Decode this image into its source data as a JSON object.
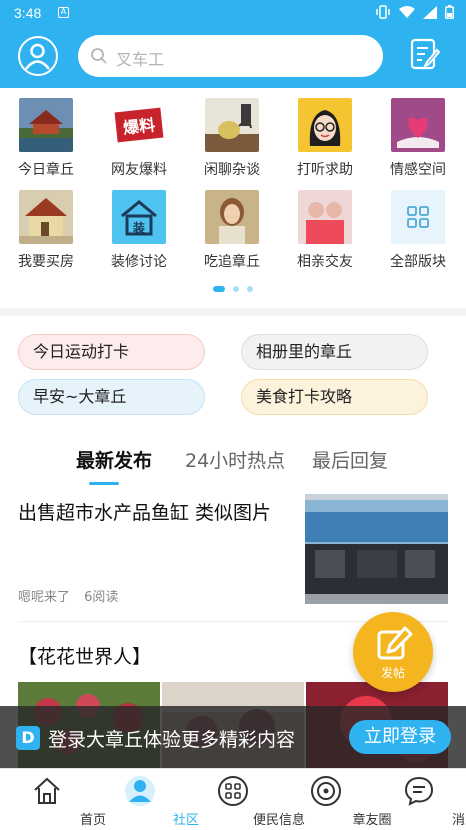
{
  "status_bar": {
    "time": "3:48",
    "notification_icon": "A"
  },
  "header": {
    "search_placeholder": "叉车工",
    "avatar_icon": "user-icon",
    "edit_icon": "edit-icon",
    "accent_color": "#2fb3f0"
  },
  "categories": [
    {
      "label": "今日章丘",
      "icon": "pavilion-photo"
    },
    {
      "label": "网友爆料",
      "icon": "baoliao-stamp"
    },
    {
      "label": "闲聊杂谈",
      "icon": "teapot-photo"
    },
    {
      "label": "打听求助",
      "icon": "girl-glasses-cartoon"
    },
    {
      "label": "情感空间",
      "icon": "book-heart-photo"
    },
    {
      "label": "我要买房",
      "icon": "house-photo"
    },
    {
      "label": "装修讨论",
      "icon": "decor-icon"
    },
    {
      "label": "吃追章丘",
      "icon": "girl-eating-photo"
    },
    {
      "label": "相亲交友",
      "icon": "couple-photo"
    },
    {
      "label": "全部版块",
      "icon": "grid-icon"
    }
  ],
  "tags": [
    {
      "label": "今日运动打卡"
    },
    {
      "label": "相册里的章丘"
    },
    {
      "label": "早安~大章丘"
    },
    {
      "label": "美食打卡攻略"
    }
  ],
  "tabs": [
    {
      "label": "最新发布",
      "active": true
    },
    {
      "label": "24小时热点",
      "active": false
    },
    {
      "label": "最后回复",
      "active": false
    }
  ],
  "posts": [
    {
      "title": "出售超市水产品鱼缸  类似图片",
      "author": "嗯呢来了",
      "reads": "6阅读"
    },
    {
      "title": "【花花世界人】"
    }
  ],
  "fab": {
    "label": "发帖"
  },
  "login_banner": {
    "logo": "D",
    "text": "登录大章丘体验更多精彩内容",
    "button": "立即登录"
  },
  "bottom_nav": [
    {
      "label": "首页",
      "icon": "home-icon",
      "active": false
    },
    {
      "label": "社区",
      "icon": "community-icon",
      "active": true
    },
    {
      "label": "便民信息",
      "icon": "services-icon",
      "active": false
    },
    {
      "label": "章友圈",
      "icon": "circle-icon",
      "active": false
    },
    {
      "label": "消息",
      "icon": "message-icon",
      "active": false
    }
  ]
}
